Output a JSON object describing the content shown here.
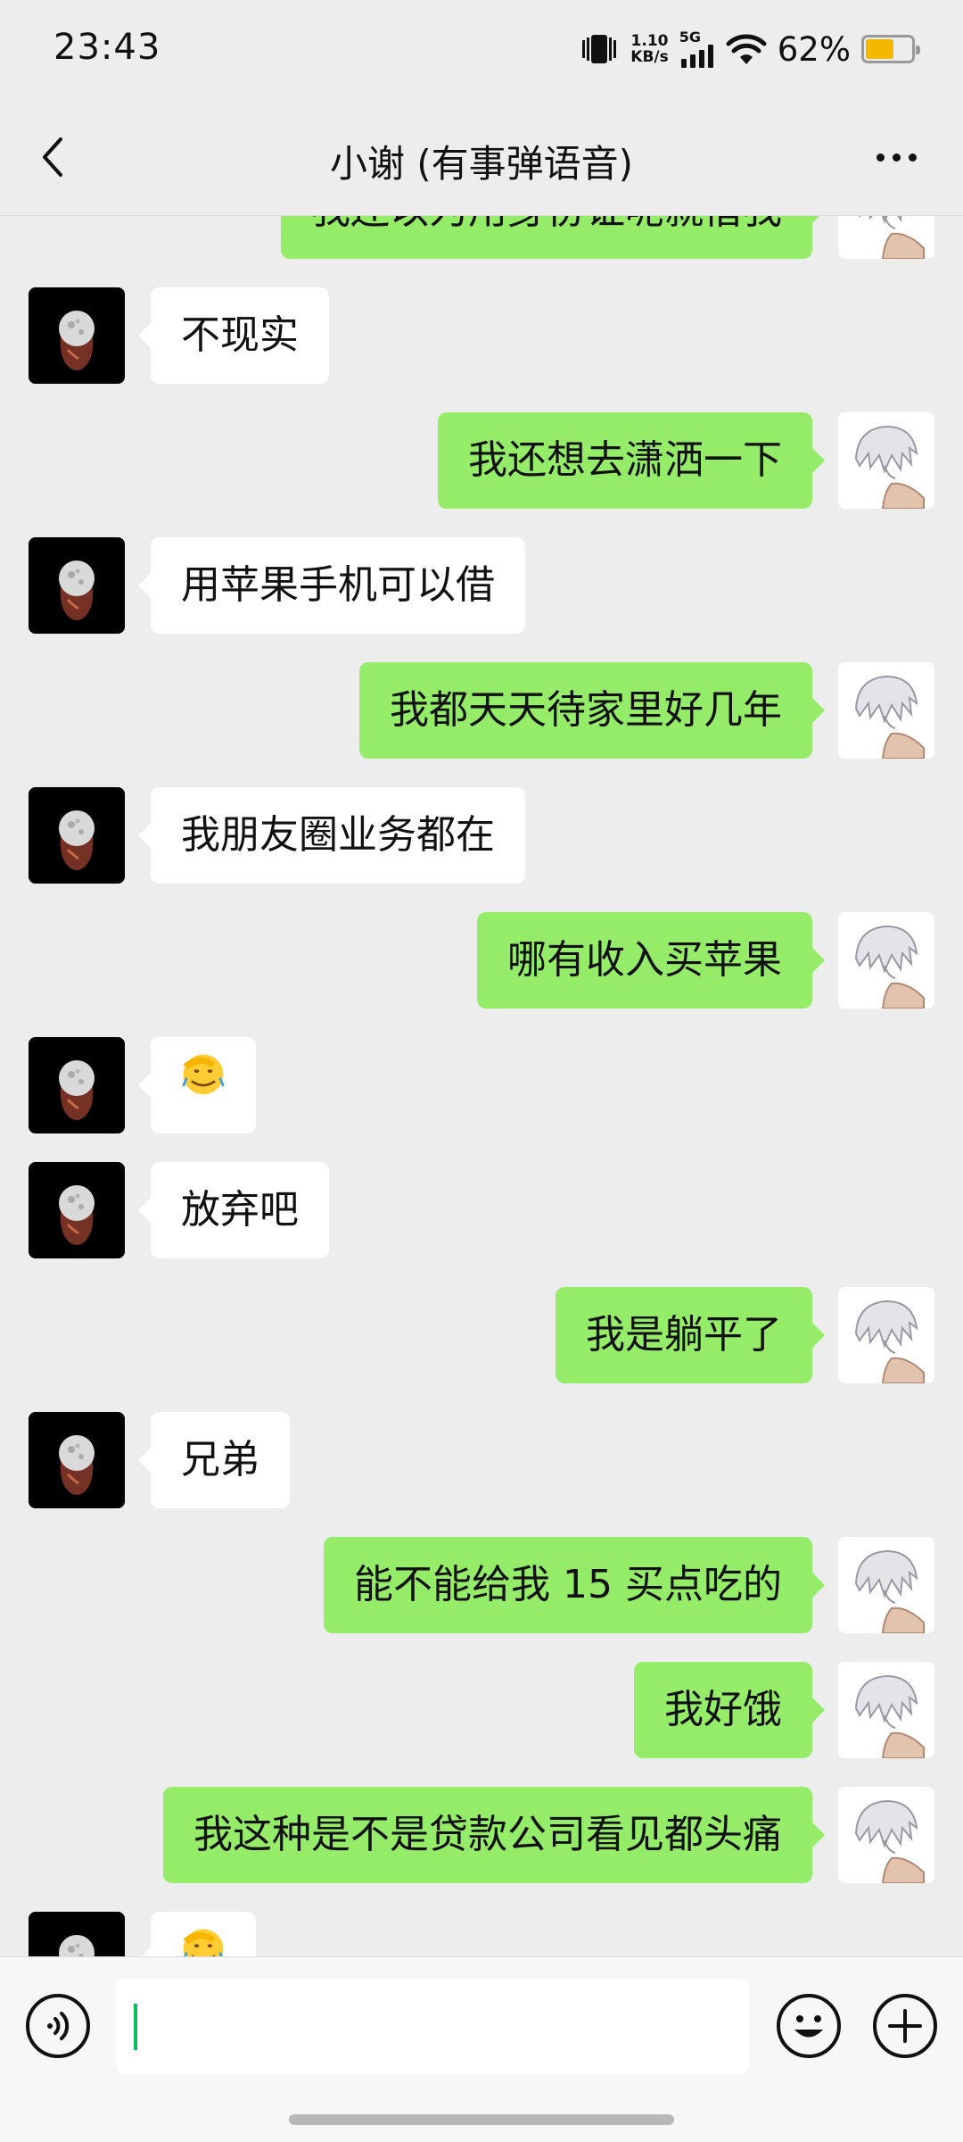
{
  "status_bar": {
    "time": "23:43",
    "net_speed_value": "1.10",
    "net_speed_unit": "KB/s",
    "network": "5G",
    "battery_percent": "62%",
    "battery_level": 0.62,
    "battery_color": "#F5B800",
    "icons": [
      "vibrate-icon",
      "signal-icon",
      "wifi-icon",
      "battery-icon"
    ]
  },
  "header": {
    "title": "小谢 (有事弹语音)",
    "back_icon": "chevron-left-icon",
    "more_icon": "more-dots-icon"
  },
  "colors": {
    "sent_bubble": "#95EC69",
    "received_bubble": "#FFFFFF",
    "background": "#EDEDED",
    "caret": "#07C160"
  },
  "messages": [
    {
      "side": "right",
      "text": "我还以为用身份证呢就借我"
    },
    {
      "side": "left",
      "text": "不现实"
    },
    {
      "side": "right",
      "text": "我还想去潇洒一下"
    },
    {
      "side": "left",
      "text": "用苹果手机可以借"
    },
    {
      "side": "right",
      "text": "我都天天待家里好几年"
    },
    {
      "side": "left",
      "text": "我朋友圈业务都在"
    },
    {
      "side": "right",
      "text": "哪有收入买苹果"
    },
    {
      "side": "left",
      "text": "",
      "emoji": "facepalm-emoji"
    },
    {
      "side": "left",
      "text": "放弃吧"
    },
    {
      "side": "right",
      "text": "我是躺平了"
    },
    {
      "side": "left",
      "text": "兄弟"
    },
    {
      "side": "right",
      "text": "能不能给我 15 买点吃的"
    },
    {
      "side": "right",
      "text": "我好饿"
    },
    {
      "side": "right",
      "text": "我这种是不是贷款公司看见都头痛"
    },
    {
      "side": "left",
      "text": "",
      "emoji": "facepalm-emoji"
    }
  ],
  "input_bar": {
    "text_value": "",
    "voice_icon": "voice-icon",
    "emoji_icon": "emoji-icon",
    "plus_icon": "plus-icon"
  }
}
